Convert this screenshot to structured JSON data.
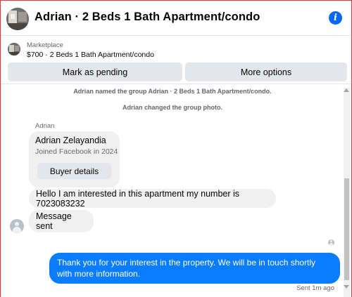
{
  "header": {
    "title": "Adrian · 2 Beds 1 Bath Apartment/condo",
    "info_icon": "info-icon",
    "accent": "#0866ff"
  },
  "marketplace": {
    "label": "Marketplace",
    "listing": "$700 · 2 Beds 1 Bath Apartment/condo",
    "mark_pending": "Mark as pending",
    "more_options": "More options"
  },
  "system_messages": [
    "Adrian named the group Adrian · 2 Beds 1 Bath Apartment/condo.",
    "Adrian changed the group photo."
  ],
  "sender_name": "Adrian",
  "profile_card": {
    "name": "Adrian Zelayandia",
    "joined": "Joined Facebook in 2024",
    "buyer_details": "Buyer details"
  },
  "incoming_messages": [
    "Hello I am interested in this apartment my number is 7023083232",
    "Message sent"
  ],
  "outgoing_message": "Thank you for your interest in the property. We will be in touch shortly with more information.",
  "outgoing_color": "#0a7cff",
  "sent_status": "Sent 1m ago"
}
